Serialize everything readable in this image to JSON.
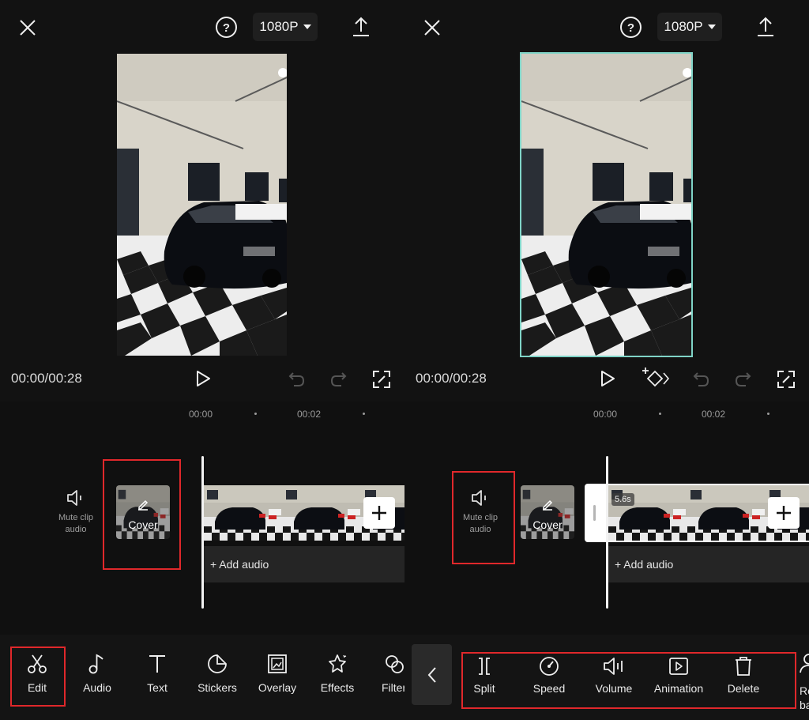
{
  "left": {
    "header": {
      "resolution": "1080P"
    },
    "playback": {
      "time": "00:00/00:28"
    },
    "ruler": [
      "00:00",
      "00:02"
    ],
    "track": {
      "mute_label": "Mute clip audio",
      "cover_label": "Cover",
      "add_audio": "+ Add audio"
    },
    "toolbar": [
      {
        "label": "Edit",
        "icon": "scissors-icon"
      },
      {
        "label": "Audio",
        "icon": "music-note-icon"
      },
      {
        "label": "Text",
        "icon": "text-icon"
      },
      {
        "label": "Stickers",
        "icon": "sticker-icon"
      },
      {
        "label": "Overlay",
        "icon": "overlay-icon"
      },
      {
        "label": "Effects",
        "icon": "effects-icon"
      },
      {
        "label": "Filter",
        "icon": "filter-icon"
      }
    ]
  },
  "right": {
    "header": {
      "resolution": "1080P"
    },
    "playback": {
      "time": "00:00/00:28"
    },
    "ruler": [
      "00:00",
      "00:02"
    ],
    "track": {
      "mute_label": "Mute clip audio",
      "cover_label": "Cover",
      "clip_duration": "5.6s",
      "add_audio": "+ Add audio"
    },
    "edit_tools": [
      {
        "label": "Split",
        "icon": "split-icon"
      },
      {
        "label": "Speed",
        "icon": "speed-icon"
      },
      {
        "label": "Volume",
        "icon": "volume-icon"
      },
      {
        "label": "Animation",
        "icon": "animation-icon"
      },
      {
        "label": "Delete",
        "icon": "trash-icon"
      },
      {
        "label": "Remove background",
        "icon": "person-icon"
      }
    ]
  },
  "colors": {
    "highlight": "#e0282b",
    "selection": "#7fd3c6",
    "background": "#121212"
  }
}
